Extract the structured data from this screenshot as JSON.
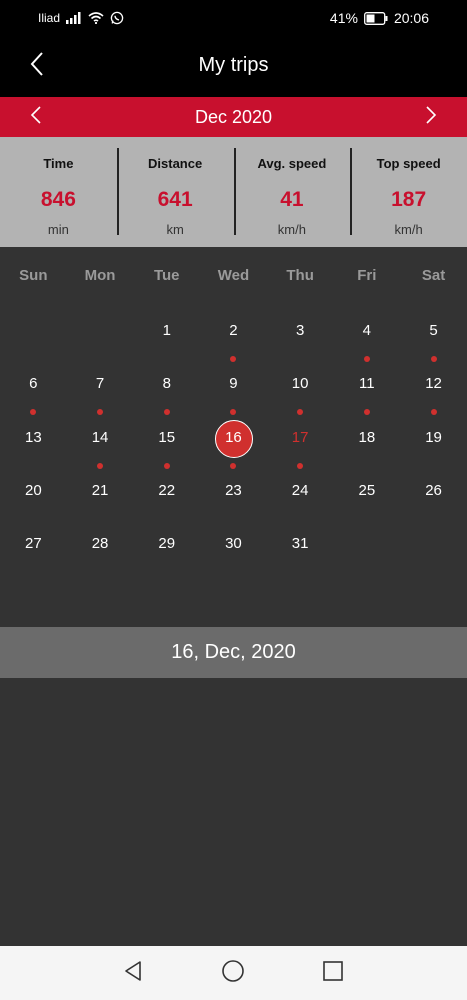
{
  "status_bar": {
    "carrier": "Iliad",
    "battery": "41%",
    "time": "20:06",
    "icons": [
      "signal-icon",
      "wifi-icon",
      "whatsapp-icon",
      "battery-icon"
    ]
  },
  "header": {
    "title": "My trips",
    "back_icon": "chevron-left-icon"
  },
  "month_nav": {
    "label": "Dec 2020",
    "prev_icon": "chevron-left-icon",
    "next_icon": "chevron-right-icon"
  },
  "stats": [
    {
      "label": "Time",
      "value": "846",
      "unit": "min"
    },
    {
      "label": "Distance",
      "value": "641",
      "unit": "km"
    },
    {
      "label": "Avg. speed",
      "value": "41",
      "unit": "km/h"
    },
    {
      "label": "Top speed",
      "value": "187",
      "unit": "km/h"
    }
  ],
  "calendar": {
    "weekdays": [
      "Sun",
      "Mon",
      "Tue",
      "Wed",
      "Thu",
      "Fri",
      "Sat"
    ],
    "first_weekday_index": 2,
    "days_in_month": 31,
    "days_with_trips": [
      2,
      4,
      5,
      6,
      7,
      8,
      9,
      10,
      11,
      12,
      14,
      15,
      16,
      17
    ],
    "selected_day": 16,
    "highlighted_day": 17
  },
  "selected_date_label": "16, Dec, 2020",
  "nav_bar": {
    "icons": [
      "back-triangle-icon",
      "home-circle-icon",
      "recents-square-icon"
    ]
  },
  "colors": {
    "accent": "#c8102e",
    "dot": "#d0302e",
    "background": "#333333",
    "stats_bg": "#b3b3b3"
  }
}
